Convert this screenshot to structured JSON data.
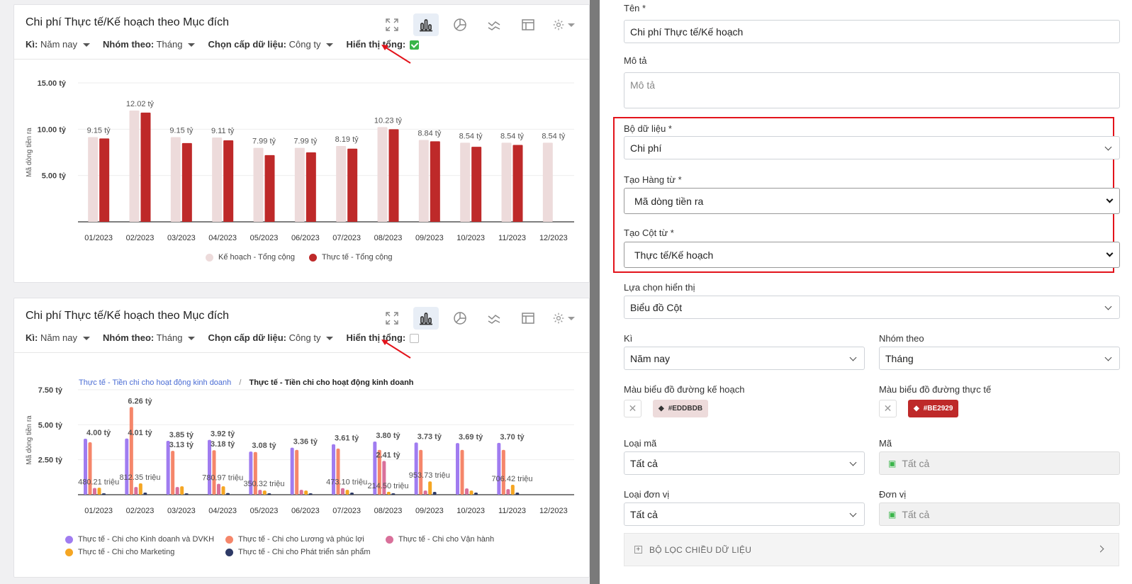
{
  "card1": {
    "title": "Chi phí Thực tế/Kế hoạch theo Mục đích",
    "filters": {
      "ki_label": "Kì:",
      "ki_value": "Năm nay",
      "group_label": "Nhóm theo:",
      "group_value": "Tháng",
      "level_label": "Chọn cấp dữ liệu:",
      "level_value": "Công ty",
      "total_label": "Hiển thị tổng:"
    },
    "show_total": true,
    "legend": [
      "Kế hoạch - Tổng cộng",
      "Thực tế - Tổng cộng"
    ]
  },
  "card2": {
    "title": "Chi phí Thực tế/Kế hoạch theo Mục đích",
    "filters": {
      "ki_label": "Kì:",
      "ki_value": "Năm nay",
      "group_label": "Nhóm theo:",
      "group_value": "Tháng",
      "level_label": "Chọn cấp dữ liệu:",
      "level_value": "Công ty",
      "total_label": "Hiển thị tổng:"
    },
    "show_total": false,
    "breadcrumb_link": "Thực tế - Tiền chi cho hoạt động kinh doanh",
    "breadcrumb_sep": "/",
    "breadcrumb_current": "Thực tế - Tiền chi cho hoạt động kinh doanh",
    "legend": [
      "Thực tế - Chi cho Kinh doanh và DVKH",
      "Thực tế - Chi cho Lương và phúc lợi",
      "Thực tế - Chi cho Vận hành",
      "Thực tế - Chi cho Marketing",
      "Thực tế - Chi cho Phát triển sản phẩm"
    ]
  },
  "colors": {
    "plan": "#EDDBDB",
    "actual": "#BE2929",
    "s1": "#a07cf0",
    "s2": "#f5866a",
    "s3": "#d9709a",
    "s4": "#f5a623",
    "s5": "#2e3a66"
  },
  "chart_data": [
    {
      "type": "bar",
      "title": "Chi phí Thực tế/Kế hoạch theo Mục đích",
      "ylabel": "Mã dòng tiền ra",
      "ylim": [
        0,
        15
      ],
      "yticks": [
        "5.00 tỷ",
        "10.00 tỷ",
        "15.00 tỷ"
      ],
      "categories": [
        "01/2023",
        "02/2023",
        "03/2023",
        "04/2023",
        "05/2023",
        "06/2023",
        "07/2023",
        "08/2023",
        "09/2023",
        "10/2023",
        "11/2023",
        "12/2023"
      ],
      "series": [
        {
          "name": "Kế hoạch - Tổng cộng",
          "values": [
            9.15,
            12.02,
            9.15,
            9.11,
            7.99,
            7.99,
            8.19,
            10.23,
            8.84,
            8.54,
            8.54,
            8.54
          ]
        },
        {
          "name": "Thực tế - Tổng cộng",
          "values": [
            9.0,
            11.8,
            8.5,
            8.8,
            7.2,
            7.5,
            7.9,
            10.0,
            8.7,
            8.1,
            8.3,
            null
          ]
        }
      ],
      "data_labels": [
        "9.15 tỷ",
        "12.02 tỷ",
        "9.15 tỷ",
        "9.11 tỷ",
        "7.99 tỷ",
        "7.99 tỷ",
        "8.19 tỷ",
        "10.23 tỷ",
        "8.84 tỷ",
        "8.54 tỷ",
        "8.54 tỷ",
        "8.54 tỷ"
      ],
      "legend_position": "bottom"
    },
    {
      "type": "bar",
      "title": "Chi phí Thực tế/Kế hoạch theo Mục đích",
      "ylabel": "Mã dòng tiền ra",
      "ylim": [
        0,
        8
      ],
      "yticks": [
        "2.50 tỷ",
        "5.00 tỷ",
        "7.50 tỷ"
      ],
      "categories": [
        "01/2023",
        "02/2023",
        "03/2023",
        "04/2023",
        "05/2023",
        "06/2023",
        "07/2023",
        "08/2023",
        "09/2023",
        "10/2023",
        "11/2023",
        "12/2023"
      ],
      "series": [
        {
          "name": "Thực tế - Chi cho Kinh doanh và DVKH",
          "values": [
            4.0,
            4.01,
            3.85,
            3.92,
            3.08,
            3.36,
            3.61,
            3.8,
            3.73,
            3.69,
            3.7,
            null
          ]
        },
        {
          "name": "Thực tế - Chi cho Lương và phúc lợi",
          "values": [
            3.75,
            6.26,
            3.13,
            3.18,
            3.05,
            3.2,
            3.3,
            3.2,
            3.2,
            3.2,
            3.2,
            null
          ]
        },
        {
          "name": "Thực tế - Chi cho Vận hành",
          "values": [
            0.48,
            0.55,
            0.55,
            0.78,
            0.35,
            0.35,
            0.47,
            2.41,
            0.3,
            0.45,
            0.4,
            null
          ]
        },
        {
          "name": "Thực tế - Chi cho Marketing",
          "values": [
            0.5,
            0.81,
            0.6,
            0.6,
            0.3,
            0.3,
            0.35,
            0.21,
            0.95,
            0.3,
            0.71,
            null
          ]
        },
        {
          "name": "Thực tế - Chi cho Phát triển sản phẩm",
          "values": [
            0.1,
            0.15,
            0.1,
            0.12,
            0.1,
            0.1,
            0.15,
            0.1,
            0.2,
            0.15,
            0.15,
            null
          ]
        }
      ],
      "data_labels": [
        {
          "cat": 0,
          "text": "4.00 tỷ",
          "v": 4.0
        },
        {
          "cat": 1,
          "text": "6.26 tỷ",
          "v": 6.26
        },
        {
          "cat": 1,
          "text": "4.01 tỷ",
          "v": 4.01
        },
        {
          "cat": 2,
          "text": "3.85 tỷ",
          "v": 3.85
        },
        {
          "cat": 2,
          "text": "3.13 tỷ",
          "v": 3.13
        },
        {
          "cat": 3,
          "text": "3.92 tỷ",
          "v": 3.92
        },
        {
          "cat": 3,
          "text": "3.18 tỷ",
          "v": 3.18
        },
        {
          "cat": 4,
          "text": "3.08 tỷ",
          "v": 3.08
        },
        {
          "cat": 5,
          "text": "3.36 tỷ",
          "v": 3.36
        },
        {
          "cat": 6,
          "text": "3.61 tỷ",
          "v": 3.61
        },
        {
          "cat": 7,
          "text": "3.80 tỷ",
          "v": 3.8
        },
        {
          "cat": 7,
          "text": "2.41 tỷ",
          "v": 2.41
        },
        {
          "cat": 8,
          "text": "3.73 tỷ",
          "v": 3.73
        },
        {
          "cat": 9,
          "text": "3.69 tỷ",
          "v": 3.69
        },
        {
          "cat": 10,
          "text": "3.70 tỷ",
          "v": 3.7
        },
        {
          "cat": 0,
          "text": "480.21 triệu",
          "v": 0.48
        },
        {
          "cat": 1,
          "text": "812.35 triệu",
          "v": 0.81
        },
        {
          "cat": 3,
          "text": "780.97 triệu",
          "v": 0.78
        },
        {
          "cat": 4,
          "text": "350.32 triệu",
          "v": 0.35
        },
        {
          "cat": 6,
          "text": "473.10 triệu",
          "v": 0.47
        },
        {
          "cat": 7,
          "text": "214.50 triệu",
          "v": 0.21
        },
        {
          "cat": 8,
          "text": "953.73 triệu",
          "v": 0.95
        },
        {
          "cat": 10,
          "text": "706.42 triệu",
          "v": 0.71
        }
      ],
      "legend_position": "bottom"
    }
  ],
  "form": {
    "name_label": "Tên *",
    "name_value": "Chi phí Thực tế/Kế hoạch",
    "desc_label": "Mô tả",
    "desc_placeholder": "Mô tả",
    "dataset_label": "Bộ dữ liệu *",
    "dataset_value": "Chi phí",
    "rows_label": "Tạo Hàng từ *",
    "rows_value": "Mã dòng tiền ra",
    "cols_label": "Tạo Cột từ *",
    "cols_value": "Thực tế/Kế hoạch",
    "display_label": "Lựa chọn hiển thị",
    "display_value": "Biểu đồ Cột",
    "ki_label": "Kì",
    "ki_value": "Năm nay",
    "group_label": "Nhóm theo",
    "group_value": "Tháng",
    "plan_color_label": "Màu biểu đồ đường kế hoạch",
    "plan_color": "#EDDBDB",
    "actual_color_label": "Màu biểu đồ đường thực tế",
    "actual_color": "#BE2929",
    "code_type_label": "Loại mã",
    "code_type_value": "Tất cả",
    "code_label": "Mã",
    "code_value": "Tất cả",
    "unit_type_label": "Loại đơn vị",
    "unit_type_value": "Tất cả",
    "unit_label": "Đơn vị",
    "unit_value": "Tất cả",
    "filter_bar": "BỘ LỌC CHIỀU DỮ LIỆU"
  }
}
